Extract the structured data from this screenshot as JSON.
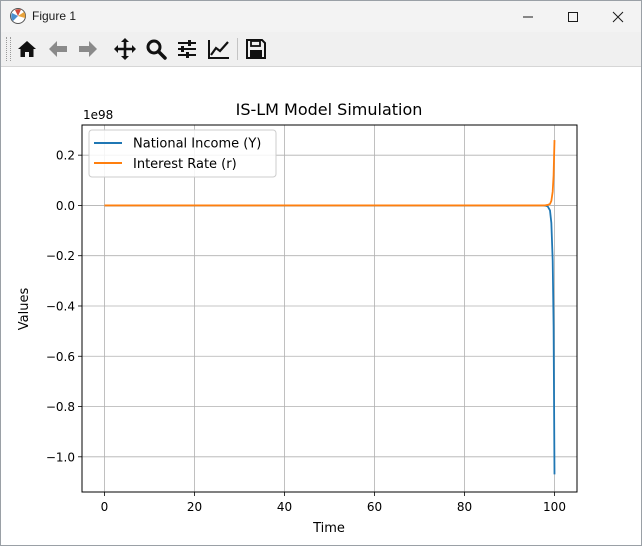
{
  "window": {
    "title": "Figure 1",
    "controls": [
      "minimize",
      "maximize",
      "close"
    ]
  },
  "toolbar": {
    "buttons": [
      {
        "name": "home",
        "icon": "home-icon"
      },
      {
        "name": "back",
        "icon": "back-arrow-icon"
      },
      {
        "name": "forward",
        "icon": "forward-arrow-icon"
      },
      {
        "name": "pan",
        "icon": "move-icon"
      },
      {
        "name": "zoom",
        "icon": "magnifier-icon"
      },
      {
        "name": "configure-subplots",
        "icon": "sliders-icon"
      },
      {
        "name": "edit-axis",
        "icon": "line-chart-icon"
      },
      {
        "name": "save",
        "icon": "floppy-disk-icon"
      }
    ]
  },
  "chart_data": {
    "type": "line",
    "title": "IS-LM Model Simulation",
    "xlabel": "Time",
    "ylabel": "Values",
    "offset_text": "1e98",
    "xlim": [
      -5,
      105
    ],
    "ylim": [
      -1.14,
      0.32
    ],
    "xticks": [
      0,
      20,
      40,
      60,
      80,
      100
    ],
    "xtick_labels": [
      "0",
      "20",
      "40",
      "60",
      "80",
      "100"
    ],
    "yticks": [
      0.2,
      0.0,
      -0.2,
      -0.4,
      -0.6,
      -0.8,
      -1.0
    ],
    "ytick_labels": [
      "0.2",
      "0.0",
      "−0.2",
      "−0.4",
      "−0.6",
      "−0.8",
      "−1.0"
    ],
    "grid": true,
    "legend_position": "upper left",
    "series": [
      {
        "name": "National Income (Y)",
        "color": "#1f77b4",
        "x": [
          0,
          10,
          20,
          30,
          40,
          50,
          60,
          70,
          80,
          90,
          96,
          97,
          97.5,
          98,
          98.5,
          99,
          99.3,
          99.6,
          99.8,
          100
        ],
        "y": [
          0,
          0,
          0,
          0,
          0,
          0,
          0,
          0,
          0,
          0,
          0,
          0,
          0,
          -0.001,
          -0.004,
          -0.02,
          -0.07,
          -0.22,
          -0.48,
          -1.07
        ]
      },
      {
        "name": "Interest Rate (r)",
        "color": "#ff7f0e",
        "x": [
          0,
          10,
          20,
          30,
          40,
          50,
          60,
          70,
          80,
          90,
          96,
          97,
          97.5,
          98,
          98.5,
          99,
          99.3,
          99.6,
          99.8,
          100
        ],
        "y": [
          0,
          0,
          0,
          0,
          0,
          0,
          0,
          0,
          0,
          0,
          0,
          0,
          0,
          0.0005,
          0.002,
          0.006,
          0.018,
          0.055,
          0.12,
          0.26
        ]
      }
    ]
  }
}
